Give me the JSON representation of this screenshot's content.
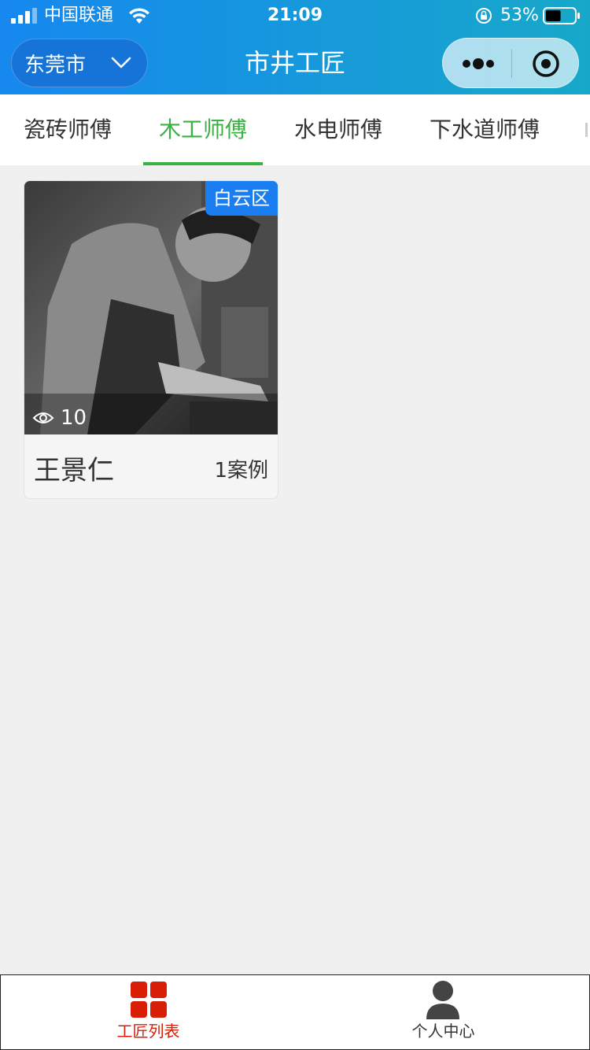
{
  "status_bar": {
    "carrier": "中国联通",
    "time": "21:09",
    "battery_percent": "53%",
    "battery_level": 0.53
  },
  "header": {
    "city": "东莞市",
    "title": "市井工匠"
  },
  "tabs": [
    {
      "label": "瓷砖师傅",
      "active": false
    },
    {
      "label": "木工师傅",
      "active": true
    },
    {
      "label": "水电师傅",
      "active": false
    },
    {
      "label": "下水道师傅",
      "active": false
    }
  ],
  "cards": [
    {
      "district": "白云区",
      "views": "10",
      "name": "王景仁",
      "cases": "1案例"
    }
  ],
  "bottom_nav": [
    {
      "label": "工匠列表",
      "icon": "grid-icon",
      "active": true
    },
    {
      "label": "个人中心",
      "icon": "person-icon",
      "active": false
    }
  ],
  "colors": {
    "header_start": "#1688ef",
    "header_end": "#17a8c9",
    "active_tab": "#3bb143",
    "badge": "#1a7ef0",
    "nav_active": "#d81e06"
  }
}
